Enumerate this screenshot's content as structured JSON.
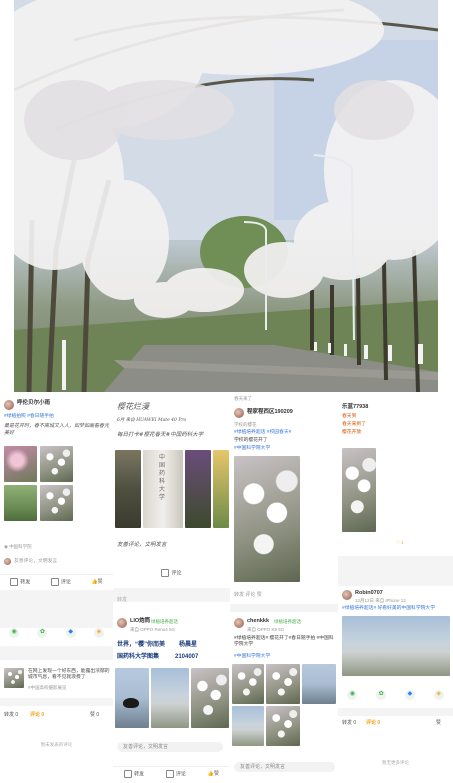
{
  "panel1": {
    "user_name": "呼伦贝尔小雨",
    "hashtag_line": "#绿植拍照 #春日随手拍",
    "handwriting": "最是花开时，春不离城又入人，如梦如画看春光美好",
    "location": "中国科学院",
    "comment_hint": "友善评论，文明发言",
    "actions": [
      "转发",
      "评论",
      "赞"
    ],
    "share_icons": [
      "wechat",
      "moments",
      "qq",
      "weibo"
    ],
    "related_title": "在网上发现一个好东西，能露出浓郁的城市气息，看不见就浪费了",
    "related_meta": "#中国高校摄影展览",
    "tab_label": "转发 0",
    "comment_tab": "评论 0",
    "like_tab": "赞 0",
    "empty_text": "暂未发表的评论"
  },
  "panel2": {
    "handwriting_top": "樱花烂漫",
    "meta_top": "6月 来自 HUAWEI Mate 40 Pro",
    "handwriting_mid": "每日打卡#樱花春天#中国药科大学",
    "stone_text": "中国药科大学",
    "comment_hint": "友善评论，文明发言",
    "comment_label": "评论",
    "share_label": "转发",
    "user_name": "LIO炮筒",
    "tag": "绿植培养超话",
    "device": "来自 OPPO Reno4 5G",
    "headline_1": "世界，“樱”你而美",
    "headline_2": "国药科大学图集",
    "author": "杨晨星",
    "number": "2104007",
    "bottom_actions": [
      "转发",
      "评论",
      "赞"
    ],
    "comment_hint_2": "友善评论，文明发言"
  },
  "panel3": {
    "header": "春天来了",
    "user_name": "程家程西区190209",
    "badge_text": "学校的樱花",
    "topic": "#中国科学院大学",
    "tag_line": "#绿植培养超话 #校园春天#",
    "post_text": "学校的樱花开了",
    "tab_bar": "转发  评论  赞",
    "user_name_2": "chenkkk",
    "tag_2": "绿植培养超话",
    "device_2": "来自 OPPO K9 5G",
    "post_text_2": "#绿植培养超话# 樱花开了#春日随手拍 #中国科学院大学",
    "topic_2": "#中国科学院大学",
    "comment_hint": "友善评论，文明发言"
  },
  "panel4": {
    "user_name": "乐蓝77938",
    "lines": [
      "春天到",
      "春天来到了",
      "樱花开放"
    ],
    "like_count": "1",
    "user_name_2": "Robin0707",
    "meta_2": "12月12日 来自 iPhone 12",
    "post_text_2": "#绿植培养超话# 好看好美的中国科学院大学",
    "share_icons": [
      "wechat",
      "moments",
      "qq",
      "weibo"
    ],
    "tab_label": "转发 0",
    "comment_tab": "评论 0",
    "like_tab": "赞",
    "empty_text": "暂无更多评论"
  },
  "colors": {
    "link": "#3a78d8",
    "accent": "#f5a623",
    "tag_green": "#4caf50"
  }
}
